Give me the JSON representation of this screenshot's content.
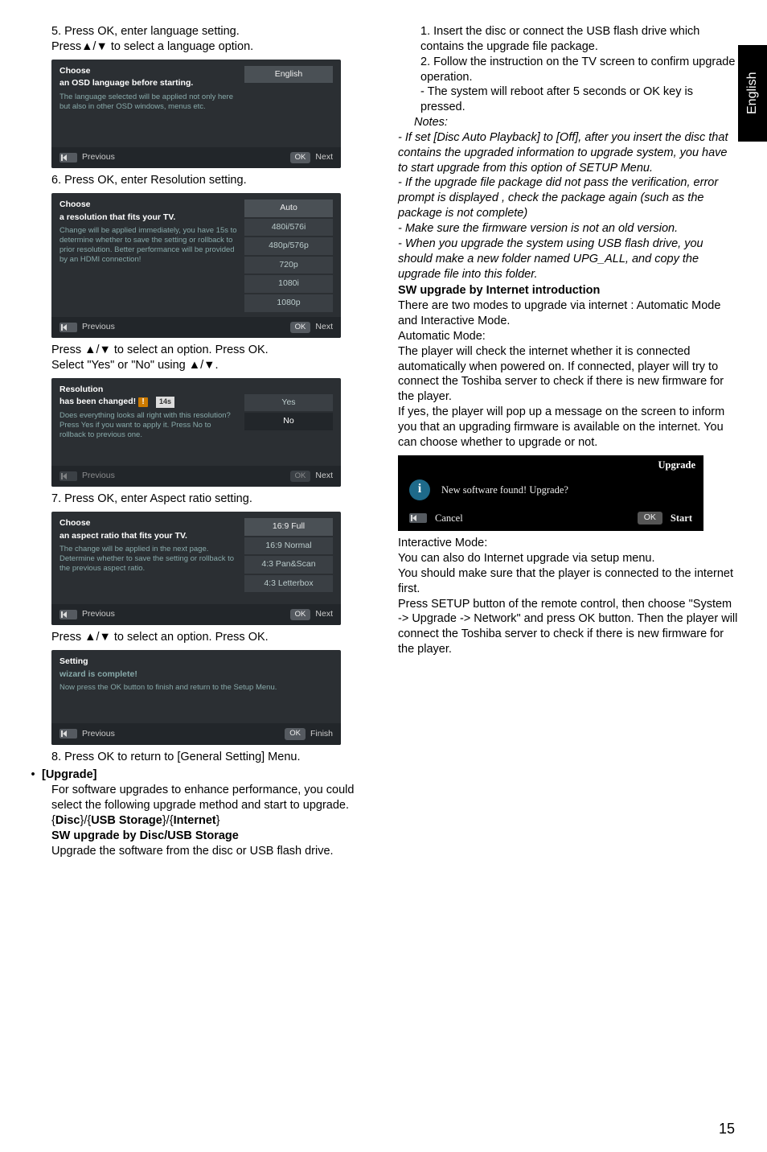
{
  "sidebar_tab": "English",
  "page_number": "15",
  "left": {
    "step5a": "5. Press OK, enter language setting.",
    "step5b": "Press▲/▼ to select a language option.",
    "shot1": {
      "title1": "Choose",
      "title2": "an OSD language before starting.",
      "desc": "The language selected will be applied not only here but also in other OSD windows, menus etc.",
      "opt": "English",
      "prev": "Previous",
      "ok": "OK",
      "next": "Next"
    },
    "step6": "6. Press OK, enter Resolution setting.",
    "shot2": {
      "title1": "Choose",
      "title2": "a resolution that fits your TV.",
      "desc": "Change will be applied immediately, you have 15s to determine whether to save the setting or rollback to prior resolution. Better performance will be provided by an HDMI connection!",
      "opts": [
        "Auto",
        "480i/576i",
        "480p/576p",
        "720p",
        "1080i",
        "1080p"
      ],
      "prev": "Previous",
      "ok": "OK",
      "next": "Next"
    },
    "step6b": "Press ▲/▼ to select an option. Press OK.",
    "step6c": "Select \"Yes\" or \"No\" using ▲/▼.",
    "shot3": {
      "title1": "Resolution",
      "title2": "has been changed!",
      "timer": "14s",
      "desc": "Does everything looks all right with this resolution? Press Yes if you want to apply it. Press No to rollback to previous one.",
      "opts": [
        "Yes",
        "No"
      ],
      "prev": "Previous",
      "ok": "OK",
      "next": "Next"
    },
    "step7": "7. Press OK, enter Aspect ratio setting.",
    "shot4": {
      "title1": "Choose",
      "title2": "an aspect ratio that fits your TV.",
      "desc": "The change will be applied in the next page. Determine whether to save the setting or rollback to the previous aspect ratio.",
      "opts": [
        "16:9 Full",
        "16:9 Normal",
        "4:3 Pan&Scan",
        "4:3 Letterbox"
      ],
      "prev": "Previous",
      "ok": "OK",
      "next": "Next"
    },
    "step7b": "Press ▲/▼ to select an option. Press OK.",
    "shot5": {
      "title1": "Setting",
      "title2": "wizard is complete!",
      "desc": "Now press the OK button to finish and return to the Setup Menu.",
      "prev": "Previous",
      "ok": "OK",
      "finish": "Finish"
    },
    "step8": "8. Press OK to return to [General Setting] Menu.",
    "upgrade_head": "[Upgrade]",
    "upgrade_p1": "For software upgrades to enhance performance, you could select the following upgrade method and start to upgrade.",
    "upgrade_opts": "{Disc}/{USB Storage}/{Internet}",
    "sw_head": "SW upgrade by Disc/USB Storage",
    "sw_p": "Upgrade the software from the disc or USB flash drive."
  },
  "right": {
    "p1": "1. Insert the disc or connect the USB flash drive which contains the upgrade file package.",
    "p2": "2. Follow the instruction on the TV screen to confirm upgrade operation.",
    "p3": "- The system will reboot after 5 seconds or OK key is pressed.",
    "notes_label": "Notes:",
    "n1": "- If set [Disc Auto Playback] to [Off], after you insert the disc that contains the upgraded information to upgrade system, you have to start upgrade from this option of SETUP Menu.",
    "n2": "- If the upgrade file package did not pass the verification, error prompt is displayed , check the package again (such as the package is not complete)",
    "n3": "- Make sure the firmware version is not an old version.",
    "n4": "- When you upgrade the system using USB flash drive, you should make a new folder named UPG_ALL, and copy the upgrade file into this folder.",
    "sw_net_head": "SW upgrade by Internet introduction",
    "sw_net_p1": "There are two modes to upgrade via internet : Automatic Mode and Interactive Mode.",
    "auto_head": "Automatic Mode:",
    "auto_p": "The player will check the internet whether it is connected automatically when powered on. If connected, player will try to connect the Toshiba server to check if there is new firmware for the player.",
    "auto_p2": "If yes, the player will pop up a message on the screen to inform you that an upgrading firmware is available on the internet. You can choose whether to upgrade or not.",
    "upg_box": {
      "title": "Upgrade",
      "msg": "New software found! Upgrade?",
      "cancel": "Cancel",
      "ok": "OK",
      "start": "Start"
    },
    "inter_head": "Interactive Mode:",
    "inter_p1": "You can also do Internet upgrade via setup menu.",
    "inter_p2": "You should make sure that the player is connected to the internet first.",
    "inter_p3": "Press SETUP button of the remote control, then choose \"System -> Upgrade -> Network\" and press OK button. Then the player will connect the Toshiba server to check if there is new firmware for the player."
  }
}
